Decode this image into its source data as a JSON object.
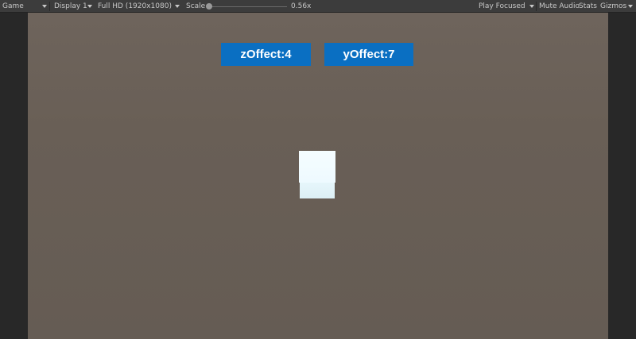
{
  "toolbar": {
    "game_label": "Game",
    "display_label": "Display 1",
    "resolution_label": "Full HD (1920x1080)",
    "scale_label": "Scale",
    "scale_value": "0.56x",
    "scale_level": 0.0,
    "play_mode_label": "Play Focused",
    "mute_label": "Mute Audio",
    "stats_label": "Stats",
    "gizmos_label": "Gizmos"
  },
  "game_view": {
    "z_offset_button": "zOffect:4",
    "y_offset_button": "yOffect:7",
    "button_color": "#0a6fc2",
    "background_color": "#675d55",
    "cube_color": "#f0fbff"
  }
}
